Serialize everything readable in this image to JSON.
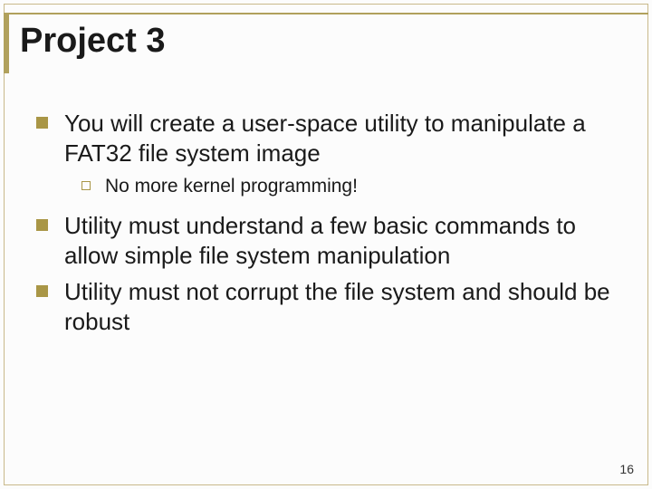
{
  "slide": {
    "title": "Project 3",
    "bullets": [
      {
        "text": "You will create a user-space utility to manipulate a FAT32 file system image",
        "children": [
          {
            "text": "No more kernel programming!"
          }
        ]
      },
      {
        "text": "Utility must understand a few basic commands to allow simple file system manipulation"
      },
      {
        "text": "Utility must not corrupt the file system and should be robust"
      }
    ],
    "page_number": "16"
  },
  "colors": {
    "accent": "#a99646",
    "border": "#c9b98a"
  }
}
